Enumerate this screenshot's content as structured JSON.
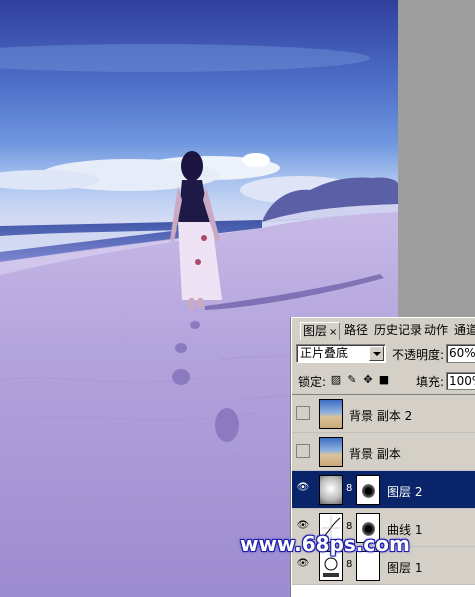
{
  "panel": {
    "tabs": [
      {
        "label": "图层",
        "close": "×"
      },
      {
        "label": "路径"
      },
      {
        "label": "历史记录"
      },
      {
        "label": "动作"
      },
      {
        "label": "通道"
      }
    ],
    "blend_mode": "正片叠底",
    "opacity_label": "不透明度:",
    "opacity_value": "60%",
    "lock_label": "锁定:",
    "fill_label": "填充:",
    "fill_value": "100%",
    "layers": [
      {
        "name": "背景 副本 2",
        "visible": false,
        "selected": false
      },
      {
        "name": "背景 副本",
        "visible": false,
        "selected": false
      },
      {
        "name": "图层 2",
        "visible": true,
        "selected": true
      },
      {
        "name": "曲线 1",
        "visible": true,
        "selected": false
      },
      {
        "name": "图层 1",
        "visible": true,
        "selected": false
      }
    ]
  },
  "watermark": "www.68ps.com",
  "colors": {
    "selection": "#0a246a",
    "panel": "#d4d0c8",
    "watermark_outline": "#1c1ca8"
  }
}
